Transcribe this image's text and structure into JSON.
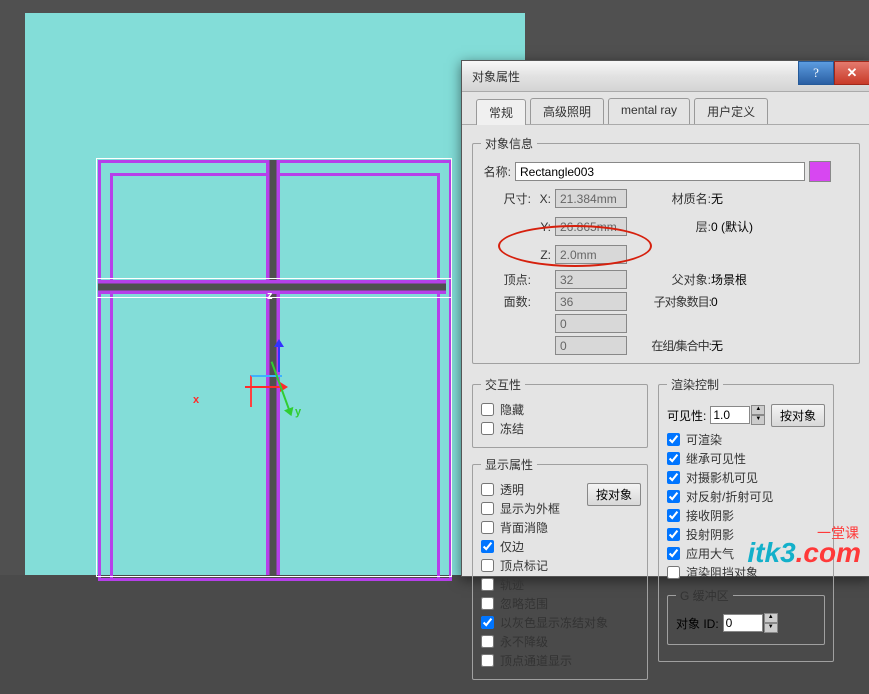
{
  "canvas": {
    "axis_x_label": "x",
    "axis_y_label": "y",
    "axis_z_label": "z"
  },
  "dialog": {
    "title": "对象属性",
    "tabs": [
      "常规",
      "高级照明",
      "mental ray",
      "用户定义"
    ],
    "active_tab": 0,
    "object_info": {
      "group_title": "对象信息",
      "name_label": "名称:",
      "name_value": "Rectangle003",
      "dim_label": "尺寸:",
      "x_label": "X:",
      "x_value": "21.384mm",
      "y_label": "Y:",
      "y_value": "26.865mm",
      "z_label": "Z:",
      "z_value": "2.0mm",
      "verts_label": "顶点:",
      "verts_value": "32",
      "faces_label": "面数:",
      "faces_value": "36",
      "blank1": "0",
      "blank2": "0",
      "material_label": "材质名:",
      "material_value": "无",
      "layer_label": "层:",
      "layer_value": "0 (默认)",
      "parent_label": "父对象:",
      "parent_value": "场景根",
      "children_label": "子对象数目:",
      "children_value": "0",
      "ingroup_label": "在组/集合中:",
      "ingroup_value": "无",
      "color_hex": "#d747f1"
    },
    "interactivity": {
      "group_title": "交互性",
      "hide_label": "隐藏",
      "hide_checked": false,
      "freeze_label": "冻结",
      "freeze_checked": false
    },
    "display": {
      "group_title": "显示属性",
      "by_object_btn": "按对象",
      "items": [
        {
          "label": "透明",
          "checked": false
        },
        {
          "label": "显示为外框",
          "checked": false
        },
        {
          "label": "背面消隐",
          "checked": false
        },
        {
          "label": "仅边",
          "checked": true
        },
        {
          "label": "顶点标记",
          "checked": false
        },
        {
          "label": "轨迹",
          "checked": false
        },
        {
          "label": "忽略范围",
          "checked": false
        },
        {
          "label": "以灰色显示冻结对象",
          "checked": true
        },
        {
          "label": "永不降级",
          "checked": false
        },
        {
          "label": "顶点通道显示",
          "checked": false
        }
      ]
    },
    "render": {
      "group_title": "渲染控制",
      "visibility_label": "可见性:",
      "visibility_value": "1.0",
      "by_object_btn": "按对象",
      "items": [
        {
          "label": "可渲染",
          "checked": true
        },
        {
          "label": "继承可见性",
          "checked": true
        },
        {
          "label": "对摄影机可见",
          "checked": true
        },
        {
          "label": "对反射/折射可见",
          "checked": true
        },
        {
          "label": "接收阴影",
          "checked": true
        },
        {
          "label": "投射阴影",
          "checked": true
        },
        {
          "label": "应用大气",
          "checked": true
        },
        {
          "label": "渲染阻挡对象",
          "checked": false
        }
      ],
      "gbuffer_title": "G 缓冲区",
      "objid_label": "对象 ID:",
      "objid_value": "0"
    }
  },
  "watermark": {
    "text_main": "itk3",
    "dot": ".",
    "com": "com",
    "sub": "一堂课"
  }
}
